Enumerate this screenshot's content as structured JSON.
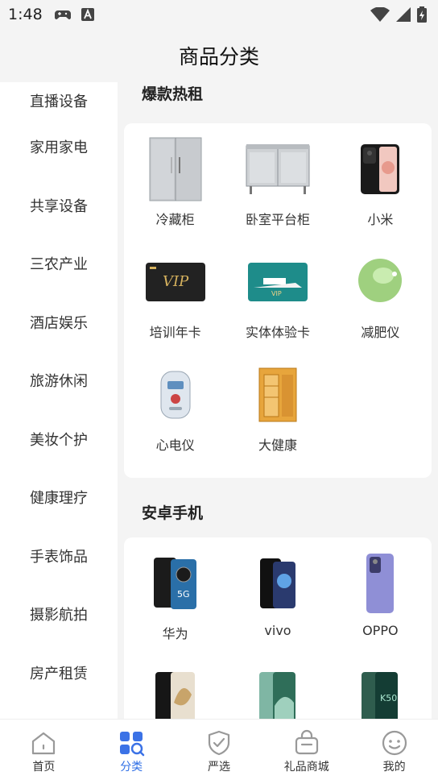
{
  "status": {
    "time": "1:48"
  },
  "header": {
    "title": "商品分类"
  },
  "sidebar": {
    "items": [
      {
        "label": "直播设备"
      },
      {
        "label": "家用家电"
      },
      {
        "label": "共享设备"
      },
      {
        "label": "三农产业"
      },
      {
        "label": "酒店娱乐"
      },
      {
        "label": "旅游休闲"
      },
      {
        "label": "美妆个护"
      },
      {
        "label": "健康理疗"
      },
      {
        "label": "手表饰品"
      },
      {
        "label": "摄影航拍"
      },
      {
        "label": "房产租赁"
      }
    ]
  },
  "sections": [
    {
      "title": "爆款热租",
      "items": [
        {
          "label": "冷藏柜",
          "icon": "fridge-image"
        },
        {
          "label": "卧室平台柜",
          "icon": "counter-fridge-image"
        },
        {
          "label": "小米",
          "icon": "phone-image"
        },
        {
          "label": "培训年卡",
          "icon": "vip-card-black-image"
        },
        {
          "label": "实体体验卡",
          "icon": "vip-card-yacht-image"
        },
        {
          "label": "减肥仪",
          "icon": "green-ball-image"
        },
        {
          "label": "心电仪",
          "icon": "ecg-device-image"
        },
        {
          "label": "大健康",
          "icon": "sauna-cabin-image"
        }
      ]
    },
    {
      "title": "安卓手机",
      "items": [
        {
          "label": "华为",
          "icon": "huawei-phone-image"
        },
        {
          "label": "vivo",
          "icon": "vivo-phone-image"
        },
        {
          "label": "OPPO",
          "icon": "oppo-phone-image"
        },
        {
          "label": "",
          "icon": "phone-gold-image"
        },
        {
          "label": "",
          "icon": "phone-green-image"
        },
        {
          "label": "",
          "icon": "phone-k50-image"
        }
      ]
    }
  ],
  "tabbar": {
    "items": [
      {
        "label": "首页"
      },
      {
        "label": "分类"
      },
      {
        "label": "严选"
      },
      {
        "label": "礼品商城"
      },
      {
        "label": "我的"
      }
    ],
    "active": "分类",
    "accent": "#2f6fe6"
  }
}
